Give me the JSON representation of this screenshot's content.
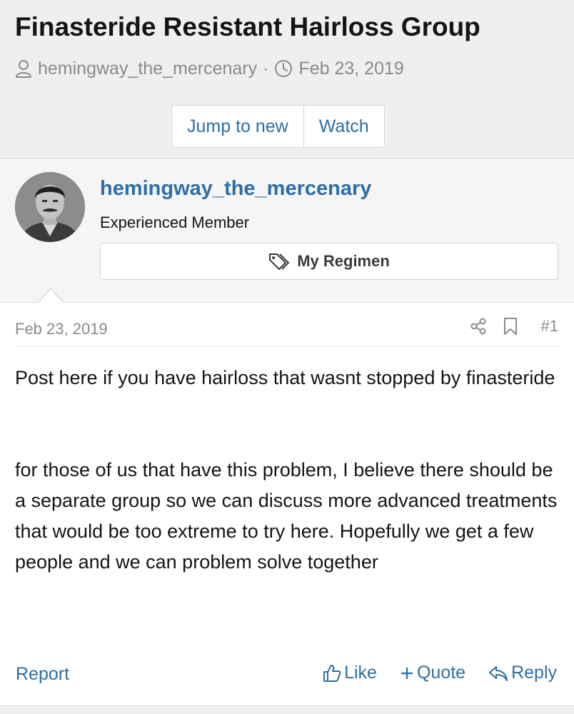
{
  "thread": {
    "title": "Finasteride Resistant Hairloss Group",
    "author": "hemingway_the_mercenary",
    "separator": "·",
    "date": "Feb 23, 2019"
  },
  "toolbar": {
    "jump_label": "Jump to new",
    "watch_label": "Watch"
  },
  "post": {
    "username": "hemingway_the_mercenary",
    "user_title": "Experienced Member",
    "regimen_label": "My Regimen",
    "date": "Feb 23, 2019",
    "number": "#1",
    "paragraphs": [
      "Post here if you have hairloss that wasnt stopped by finasteride",
      "for those of us that have this problem, I believe there should be a separate group so we can discuss more advanced treatments that would be too extreme to try here. Hopefully we get a few people and we can problem solve together"
    ]
  },
  "actions": {
    "report": "Report",
    "like": "Like",
    "quote": "Quote",
    "reply": "Reply"
  },
  "icons": {
    "author": "user-icon",
    "date": "clock-icon",
    "regimen": "tags-icon",
    "share": "share-icon",
    "bookmark": "bookmark-icon",
    "like": "thumbs-up-icon",
    "quote": "plus-icon",
    "reply": "reply-icon"
  },
  "colors": {
    "link": "#2f6ea5",
    "muted": "#8a8a8a",
    "header_bg": "#efefef"
  }
}
